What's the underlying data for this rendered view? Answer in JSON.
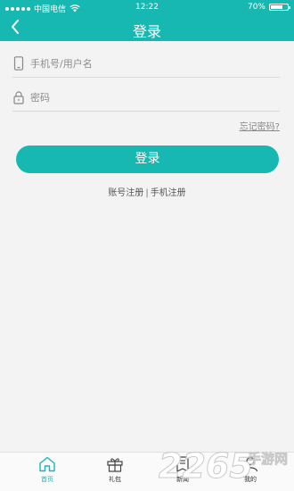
{
  "status_bar": {
    "carrier": "中国电信",
    "time": "12:22",
    "battery": "70%",
    "battery_level": 0.7
  },
  "nav": {
    "title": "登录"
  },
  "form": {
    "username_placeholder": "手机号/用户名",
    "password_placeholder": "密码",
    "forgot_link": "忘记密码?",
    "login_button": "登录"
  },
  "register": {
    "account": "账号注册",
    "separator": "|",
    "phone": "手机注册"
  },
  "tabbar": {
    "items": [
      {
        "label": "首页",
        "icon": "home-icon",
        "active": true
      },
      {
        "label": "礼包",
        "icon": "gift-icon",
        "active": false
      },
      {
        "label": "新闻",
        "icon": "news-icon",
        "active": false
      },
      {
        "label": "我的",
        "icon": "user-icon",
        "active": false
      }
    ]
  },
  "watermark": {
    "text": "2265手游网"
  },
  "colors": {
    "accent": "#18b8b2",
    "background": "#f3f3f3"
  }
}
